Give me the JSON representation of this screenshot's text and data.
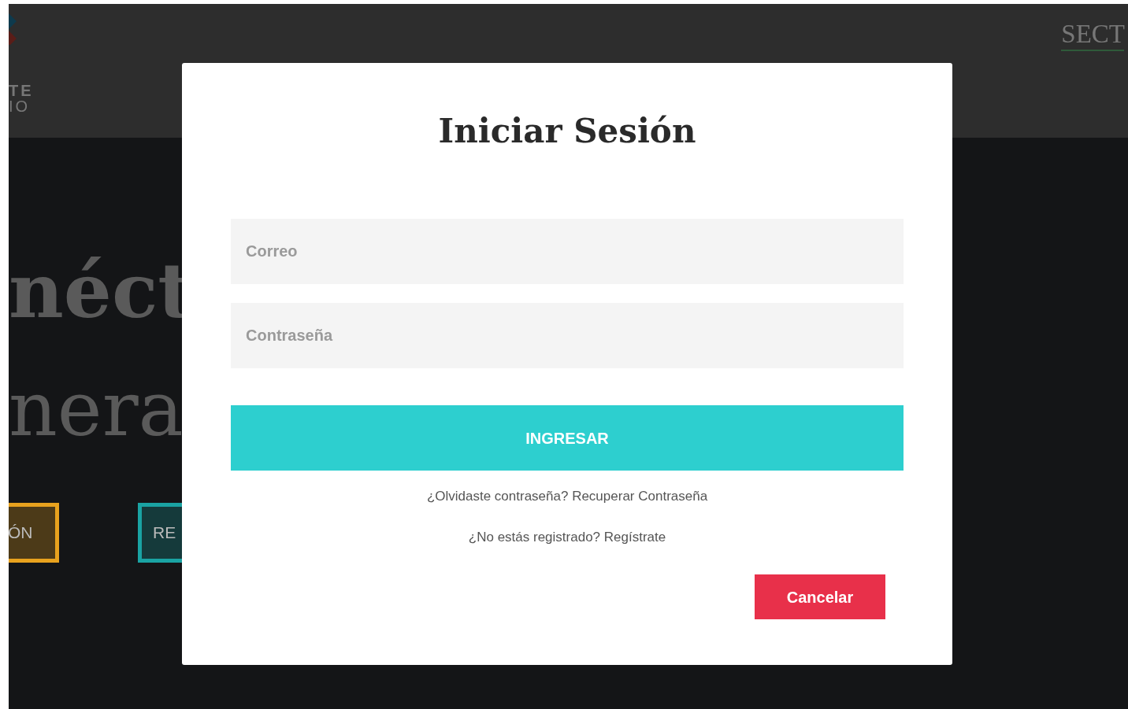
{
  "background": {
    "logo_left": {
      "line_1": "TE",
      "line_2": "IO"
    },
    "logo_right": {
      "title": "SECT"
    },
    "hero": {
      "line_1": "néct",
      "line_2": "nera"
    },
    "buttons": [
      {
        "label": "ÓN",
        "color": "#e8a21e"
      },
      {
        "label": "RE",
        "color": "#1aa3a3"
      }
    ]
  },
  "modal": {
    "title": "Iniciar Sesión",
    "fields": [
      {
        "placeholder": "Correo"
      },
      {
        "placeholder": "Contraseña"
      }
    ],
    "submit": "INGRESAR",
    "links": [
      "¿Olvidaste contraseña? Recuperar Contraseña",
      "¿No estás registrado? Regístrate"
    ],
    "cancel": "Cancelar"
  }
}
